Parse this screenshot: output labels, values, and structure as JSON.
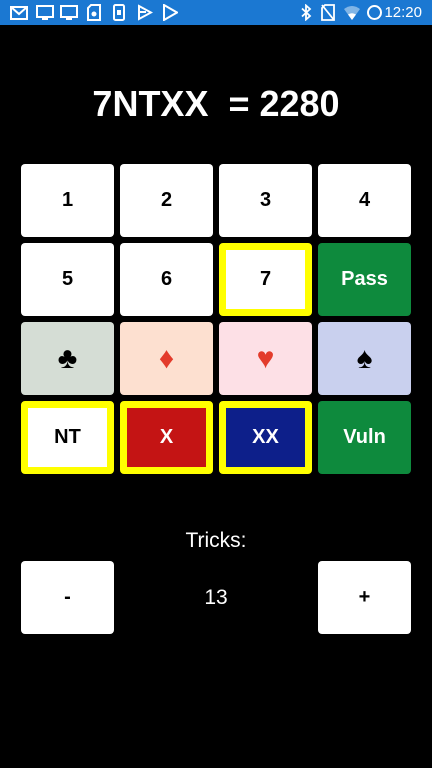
{
  "status_bar": {
    "time": "12:20",
    "background": "#1b78d2",
    "left_icons": [
      "gmail-icon",
      "screen-icon",
      "screen-icon",
      "sd-card-icon",
      "phone-icon",
      "play-icon",
      "play-store-icon"
    ],
    "right_icons": [
      "bluetooth-icon",
      "no-sim-icon",
      "wifi-icon",
      "battery-icon"
    ]
  },
  "contract": {
    "text": "7NTXX  = 2280"
  },
  "keys": {
    "row1": [
      "1",
      "2",
      "3",
      "4"
    ],
    "row2": [
      "5",
      "6",
      "7",
      "Pass"
    ],
    "suits": [
      {
        "name": "club",
        "glyph": "♣",
        "color": "#000000",
        "background": "#d5ddd5"
      },
      {
        "name": "diamond",
        "glyph": "♦",
        "color": "#e33b2b",
        "background": "#fde0d0"
      },
      {
        "name": "heart",
        "glyph": "♥",
        "color": "#e33b2b",
        "background": "#fde0e6"
      },
      {
        "name": "spade",
        "glyph": "♠",
        "color": "#000000",
        "background": "#c9d0ee"
      }
    ],
    "row4": [
      "NT",
      "X",
      "XX",
      "Vuln"
    ]
  },
  "colors": {
    "selected_border": "#ffff00",
    "pass_green": "#0e8a3d",
    "double_red": "#c41414",
    "redouble_blue": "#0d1f8a"
  },
  "tricks": {
    "label": "Tricks:",
    "value": "13",
    "minus": "-",
    "plus": "+"
  }
}
